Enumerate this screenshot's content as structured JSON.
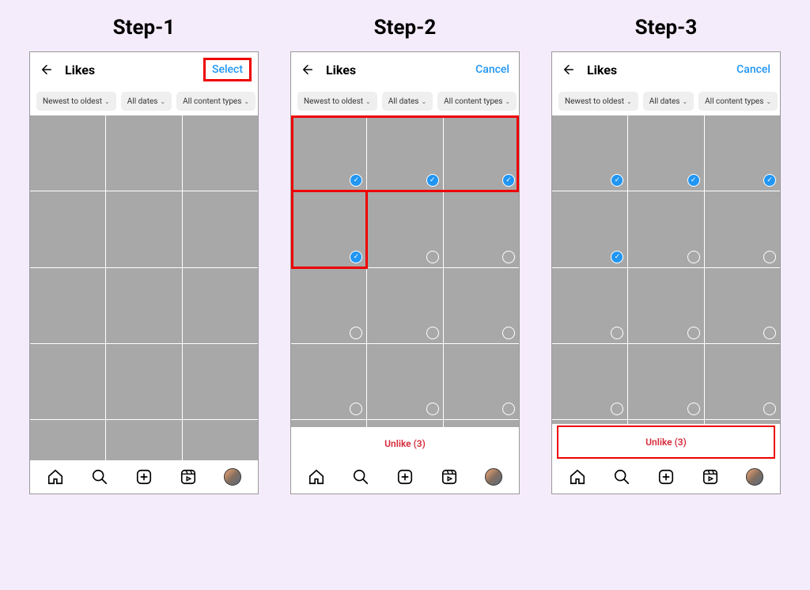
{
  "steps": [
    {
      "title": "Step-1"
    },
    {
      "title": "Step-2"
    },
    {
      "title": "Step-3"
    }
  ],
  "header": {
    "page_title": "Likes",
    "select_label": "Select",
    "cancel_label": "Cancel"
  },
  "filters": {
    "sort": "Newest to oldest",
    "dates": "All dates",
    "content": "All content types"
  },
  "unlike": {
    "label_prefix": "Unlike (",
    "count": 3,
    "label_suffix": ")"
  },
  "selection": {
    "row1": [
      true,
      true,
      true
    ],
    "row2": [
      true,
      false,
      false
    ],
    "row3": [
      false,
      false,
      false
    ],
    "row4": [
      false,
      false,
      false
    ]
  }
}
